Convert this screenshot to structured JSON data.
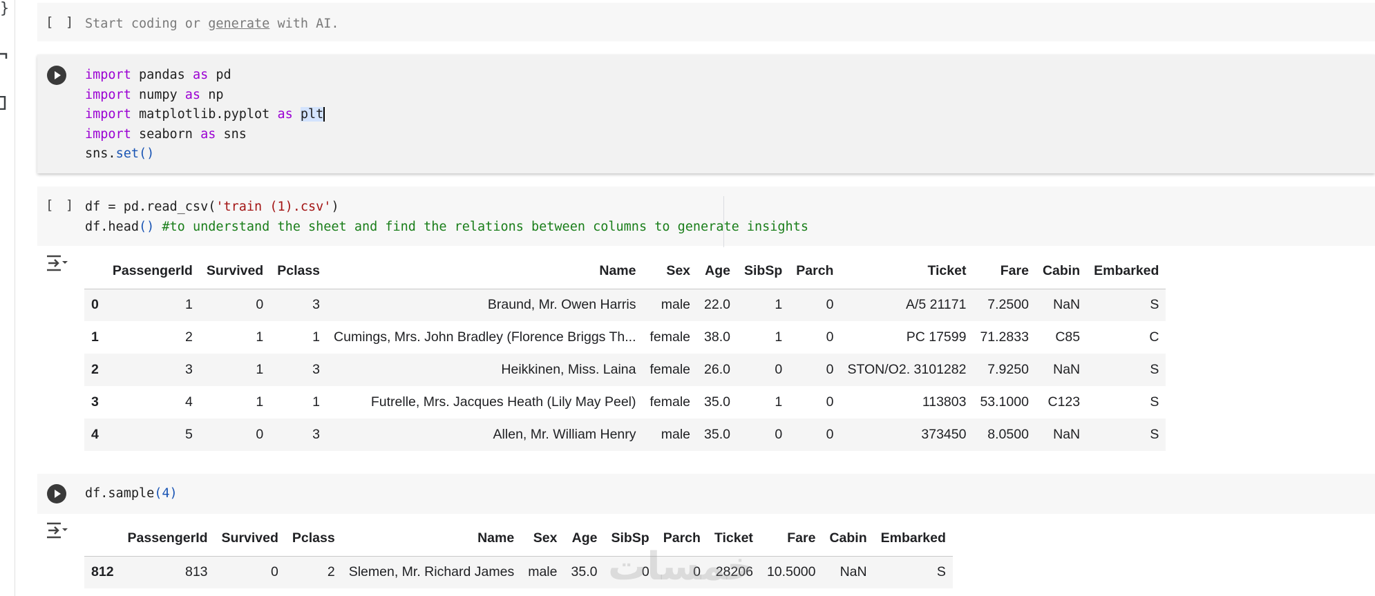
{
  "rail": {
    "brace": "}"
  },
  "cells": {
    "empty": {
      "bracket": "[ ]",
      "placeholder_prefix": "Start coding or ",
      "placeholder_link": "generate",
      "placeholder_suffix": " with AI."
    },
    "imports": {
      "lines": [
        {
          "kw": "import",
          "mod": " pandas ",
          "as": "as",
          "alias": " pd"
        },
        {
          "kw": "import",
          "mod": " numpy ",
          "as": "as",
          "alias": " np"
        },
        {
          "kw": "import",
          "mod": " matplotlib.pyplot ",
          "as": "as",
          "alias": "plt"
        },
        {
          "kw": "import",
          "mod": " seaborn ",
          "as": "as",
          "alias": " sns"
        }
      ],
      "last_prefix": "sns.",
      "last_call": "set()"
    },
    "read": {
      "bracket": "[ ]",
      "line1_prefix": "df = pd.read_csv(",
      "line1_str": "'train (1).csv'",
      "line1_suffix": ")",
      "line2_prefix": "df.head",
      "line2_call": "()",
      "line2_comment": " #to understand the sheet and find the relations between columns to generate insights"
    },
    "sample": {
      "prefix": "df.sample",
      "arg": "(4)"
    }
  },
  "head_table": {
    "columns": [
      "",
      "PassengerId",
      "Survived",
      "Pclass",
      "Name",
      "Sex",
      "Age",
      "SibSp",
      "Parch",
      "Ticket",
      "Fare",
      "Cabin",
      "Embarked"
    ],
    "rows": [
      [
        "0",
        "1",
        "0",
        "3",
        "Braund, Mr. Owen Harris",
        "male",
        "22.0",
        "1",
        "0",
        "A/5 21171",
        "7.2500",
        "NaN",
        "S"
      ],
      [
        "1",
        "2",
        "1",
        "1",
        "Cumings, Mrs. John Bradley (Florence Briggs Th...",
        "female",
        "38.0",
        "1",
        "0",
        "PC 17599",
        "71.2833",
        "C85",
        "C"
      ],
      [
        "2",
        "3",
        "1",
        "3",
        "Heikkinen, Miss. Laina",
        "female",
        "26.0",
        "0",
        "0",
        "STON/O2. 3101282",
        "7.9250",
        "NaN",
        "S"
      ],
      [
        "3",
        "4",
        "1",
        "1",
        "Futrelle, Mrs. Jacques Heath (Lily May Peel)",
        "female",
        "35.0",
        "1",
        "0",
        "113803",
        "53.1000",
        "C123",
        "S"
      ],
      [
        "4",
        "5",
        "0",
        "3",
        "Allen, Mr. William Henry",
        "male",
        "35.0",
        "0",
        "0",
        "373450",
        "8.0500",
        "NaN",
        "S"
      ]
    ]
  },
  "sample_table": {
    "columns": [
      "",
      "PassengerId",
      "Survived",
      "Pclass",
      "Name",
      "Sex",
      "Age",
      "SibSp",
      "Parch",
      "Ticket",
      "Fare",
      "Cabin",
      "Embarked"
    ],
    "rows": [
      [
        "812",
        "813",
        "0",
        "2",
        "Slemen, Mr. Richard James",
        "male",
        "35.0",
        "0",
        "0",
        "28206",
        "10.5000",
        "NaN",
        "S"
      ],
      [
        "",
        "",
        "",
        "",
        "",
        "",
        "",
        "",
        "",
        "",
        "",
        "",
        ""
      ]
    ]
  },
  "watermark": "خمسات",
  "colors": {
    "keyword": "#9b00d3",
    "string": "#a31515",
    "comment": "#1a7e1a",
    "function": "#1a55b4",
    "cell_bg": "#f7f7f7"
  }
}
